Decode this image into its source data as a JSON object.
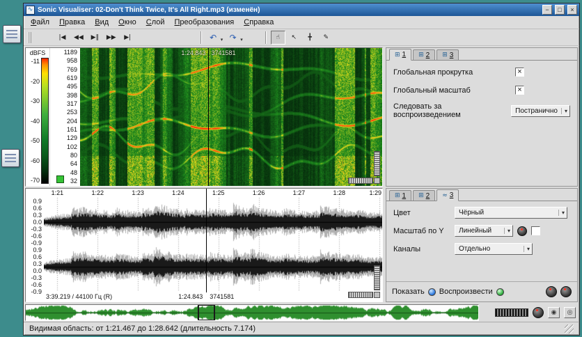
{
  "window": {
    "title": "Sonic Visualiser: 02-Don't Think Twice, It's All Right.mp3 (изменён)",
    "minimize_glyph": "−",
    "maximize_glyph": "□",
    "close_glyph": "×"
  },
  "menubar": {
    "items": [
      "Файл",
      "Правка",
      "Вид",
      "Окно",
      "Слой",
      "Преобразования",
      "Справка"
    ]
  },
  "toolbar": {
    "transport": [
      {
        "id": "rewind-to-start",
        "glyph": "|◀"
      },
      {
        "id": "rewind",
        "glyph": "◀◀"
      },
      {
        "id": "play-pause",
        "glyph": "▶‖"
      },
      {
        "id": "fast-forward",
        "glyph": "▶▶"
      },
      {
        "id": "forward-to-end",
        "glyph": "▶|"
      }
    ],
    "undo_glyph": "↶",
    "redo_glyph": "↷",
    "dropdown_arrow": "▾",
    "tools": [
      {
        "id": "navigate",
        "glyph": "☝"
      },
      {
        "id": "select",
        "glyph": "↖"
      },
      {
        "id": "edit",
        "glyph": "╋"
      },
      {
        "id": "draw",
        "glyph": "✎"
      }
    ]
  },
  "spectrogram": {
    "scale_unit": "dBFS",
    "db_ticks": [
      "-11",
      "-20",
      "-30",
      "-40",
      "-50",
      "-60",
      "-70"
    ],
    "freq_ticks": [
      "1189",
      "958",
      "769",
      "619",
      "495",
      "398",
      "317",
      "253",
      "204",
      "161",
      "129",
      "102",
      "80",
      "64",
      "48",
      "32"
    ],
    "cursor_time": "1:24.843",
    "cursor_sample": "3741581"
  },
  "waveform": {
    "time_ticks": [
      "1:21",
      "1:22",
      "1:23",
      "1:24",
      "1:25",
      "1:26",
      "1:27",
      "1:28",
      "1:29"
    ],
    "amp_ticks": [
      "0.9",
      "0.6",
      "0.3",
      "0.0",
      "-0.3",
      "-0.6",
      "-0.9"
    ],
    "track_info": "3:39.219 / 44100 Гц (R)",
    "cursor_time": "1:24.843",
    "cursor_sample": "3741581"
  },
  "pane_props": {
    "tabs": [
      {
        "icon": "⊞",
        "label": "1"
      },
      {
        "icon": "⊞",
        "label": "2"
      },
      {
        "icon": "⊞",
        "label": "3"
      }
    ],
    "check_glyph": "×",
    "rows": {
      "global_scroll": "Глобальная прокрутка",
      "global_zoom": "Глобальный масштаб",
      "follow_playback": "Следовать за воспроизведением",
      "follow_value": "Постранично"
    }
  },
  "layer_props": {
    "tabs": [
      {
        "icon": "⊞",
        "label": "1"
      },
      {
        "icon": "⊞",
        "label": "2"
      },
      {
        "icon": "≈",
        "label": "3"
      }
    ],
    "rows": {
      "colour_label": "Цвет",
      "colour_value": "Чёрный",
      "scale_label": "Масштаб по Y",
      "scale_value": "Линейный",
      "channels_label": "Каналы",
      "channels_value": "Отдельно"
    },
    "show_label": "Показать",
    "play_label": "Воспроизвести"
  },
  "overview": {
    "button1_glyph": "◉",
    "button2_glyph": "◎"
  },
  "statusbar": {
    "text": "Видимая область: от 1:21.467 до 1:28.642 (длительность 7.174)"
  }
}
